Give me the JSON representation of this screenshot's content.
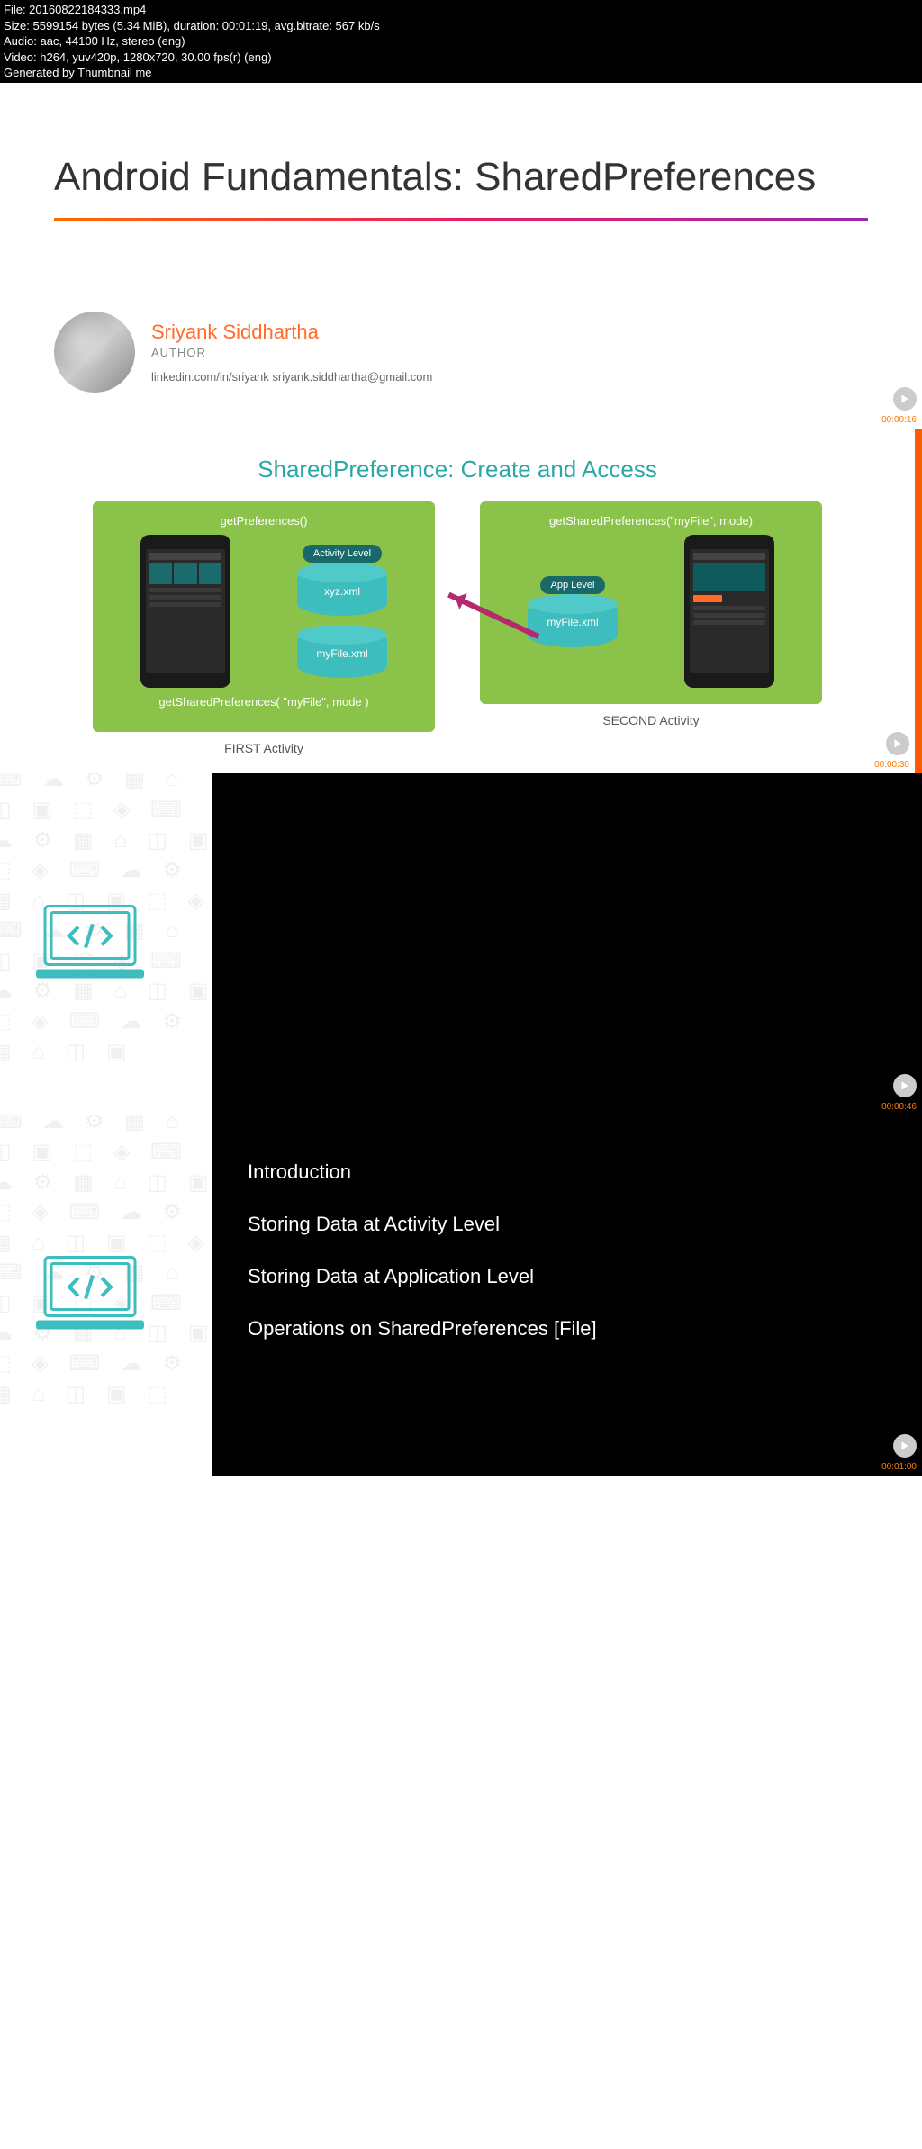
{
  "file_info": {
    "line1": "File: 20160822184333.mp4",
    "line2": "Size: 5599154 bytes (5.34 MiB), duration: 00:01:19, avg.bitrate: 567 kb/s",
    "line3": "Audio: aac, 44100 Hz, stereo (eng)",
    "line4": "Video: h264, yuv420p, 1280x720, 30.00 fps(r) (eng)",
    "line5": "Generated by Thumbnail me"
  },
  "slide1": {
    "title": "Android Fundamentals: SharedPreferences",
    "author_name": "Sriyank Siddhartha",
    "author_role": "AUTHOR",
    "author_links": "linkedin.com/in/sriyank   sriyank.siddhartha@gmail.com",
    "timestamp": "00:00:16"
  },
  "slide2": {
    "title": "SharedPreference: Create and Access",
    "left_code_top": "getPreferences()",
    "left_cyl1_label": "Activity Level",
    "left_cyl1_file": "xyz.xml",
    "left_cyl2_file": "myFile.xml",
    "left_code_bottom": "getSharedPreferences( \"myFile\", mode )",
    "left_activity": "FIRST Activity",
    "right_code_top": "getSharedPreferences(\"myFile\", mode)",
    "right_cyl_label": "App Level",
    "right_cyl_file": "myFile.xml",
    "right_activity": "SECOND Activity",
    "timestamp": "00:00:30"
  },
  "slide3": {
    "timestamp": "00:00:46"
  },
  "slide4": {
    "items": [
      "Introduction",
      "Storing Data at Activity Level",
      "Storing Data at Application Level",
      "Operations on SharedPreferences [File]"
    ],
    "timestamp": "00:01:00"
  }
}
